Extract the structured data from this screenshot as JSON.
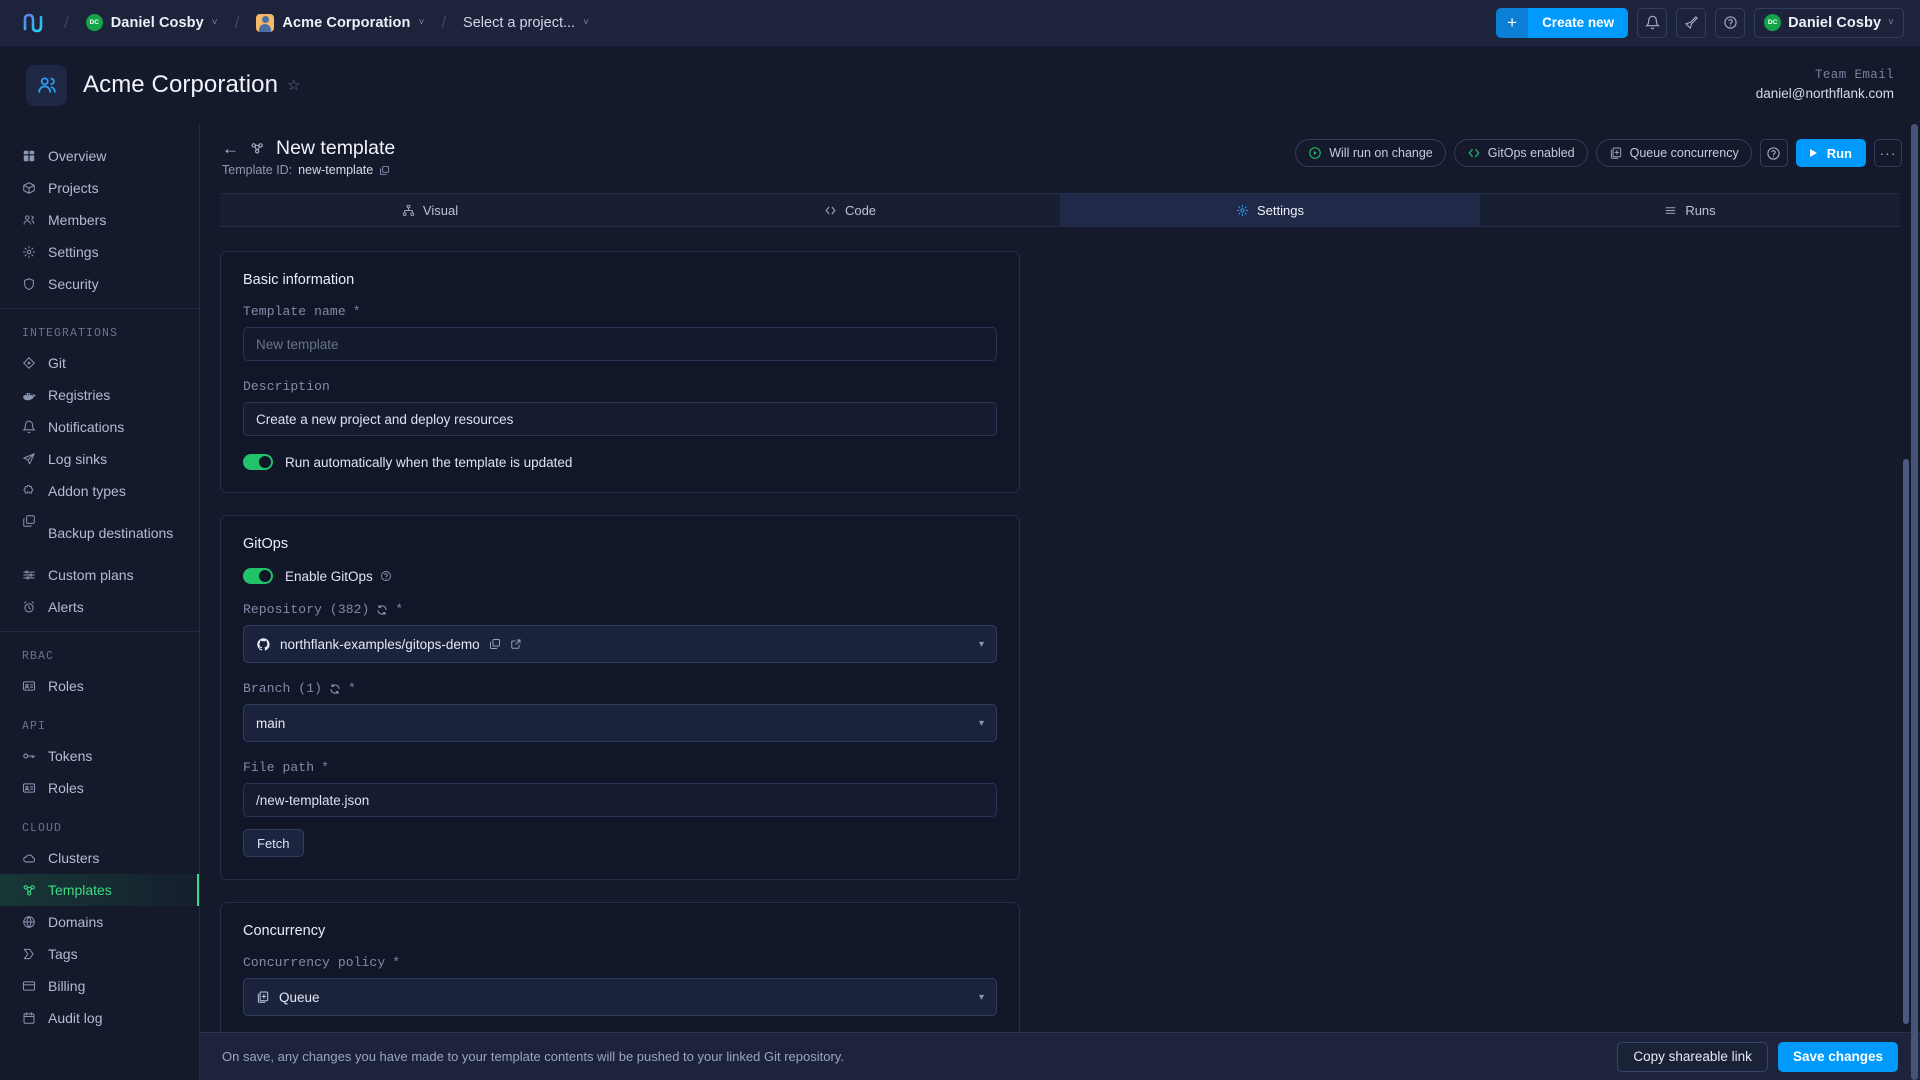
{
  "topbar": {
    "logo_icon": "northflank-logo-icon",
    "user": {
      "label": "Daniel Cosby",
      "avatar_initials": "DC",
      "chevron": "˅"
    },
    "team": {
      "label": "Acme Corporation",
      "chevron": "˅"
    },
    "project_selector": {
      "label": "Select a project...",
      "chevron": "˅"
    },
    "separator": "/",
    "create_new": {
      "plus": "+",
      "label": "Create new"
    },
    "icons": [
      "bell-icon",
      "rocket-icon",
      "help-icon"
    ],
    "account": {
      "label": "Daniel Cosby",
      "avatar_initials": "DC",
      "chevron": "˅"
    }
  },
  "team_header": {
    "avatar_icon": "team-people-icon",
    "title": "Acme Corporation",
    "star": "☆",
    "email_label": "Team Email",
    "email_value": "daniel@northflank.com"
  },
  "sidebar": {
    "items": [
      {
        "label": "Overview",
        "icon": "grid-icon",
        "active": false
      },
      {
        "label": "Projects",
        "icon": "box-icon",
        "active": false
      },
      {
        "label": "Members",
        "icon": "people-icon",
        "active": false
      },
      {
        "label": "Settings",
        "icon": "gear-icon",
        "active": false
      },
      {
        "label": "Security",
        "icon": "shield-icon",
        "active": false
      }
    ],
    "groups": [
      {
        "label": "INTEGRATIONS",
        "items": [
          {
            "label": "Git",
            "icon": "git-icon",
            "active": false
          },
          {
            "label": "Registries",
            "icon": "docker-icon",
            "active": false
          },
          {
            "label": "Notifications",
            "icon": "bell-icon",
            "active": false
          },
          {
            "label": "Log sinks",
            "icon": "send-icon",
            "active": false
          },
          {
            "label": "Addon types",
            "icon": "puzzle-icon",
            "active": false
          },
          {
            "label": "Backup destinations",
            "icon": "copy-icon",
            "active": false,
            "two_line": true
          },
          {
            "label": "Custom plans",
            "icon": "sliders-icon",
            "active": false
          },
          {
            "label": "Alerts",
            "icon": "alarm-icon",
            "active": false
          }
        ]
      },
      {
        "label": "RBAC",
        "items": [
          {
            "label": "Roles",
            "icon": "id-card-icon",
            "active": false
          }
        ]
      },
      {
        "label": "API",
        "items": [
          {
            "label": "Tokens",
            "icon": "key-icon",
            "active": false
          },
          {
            "label": "Roles",
            "icon": "id-card-icon",
            "active": false
          }
        ]
      },
      {
        "label": "CLOUD",
        "items": [
          {
            "label": "Clusters",
            "icon": "cloud-icon",
            "active": false
          },
          {
            "label": "Templates",
            "icon": "template-icon",
            "active": true
          },
          {
            "label": "Domains",
            "icon": "globe-icon",
            "active": false
          },
          {
            "label": "Tags",
            "icon": "tag-icon",
            "active": false
          },
          {
            "label": "Billing",
            "icon": "card-icon",
            "active": false
          },
          {
            "label": "Audit log",
            "icon": "calendar-icon",
            "active": false
          }
        ]
      }
    ]
  },
  "page": {
    "back_arrow": "←",
    "title_icon": "template-icon",
    "title": "New template",
    "template_id_label": "Template ID:",
    "template_id_value": "new-template",
    "copy_icon": "copy-icon",
    "pills": [
      {
        "label": "Will run on change",
        "icon": "play-circle-icon",
        "icon_color": "#21c26a"
      },
      {
        "label": "GitOps enabled",
        "icon": "code-icon",
        "icon_color": "#21c26a"
      },
      {
        "label": "Queue concurrency",
        "icon": "queue-icon",
        "icon_color": "#9aa5c0"
      }
    ],
    "help_icon": "help-icon",
    "run_button": {
      "label": "Run",
      "icon": "play-icon"
    },
    "more_button": "···",
    "tabs": [
      {
        "label": "Visual",
        "icon": "sitemap-icon",
        "active": false
      },
      {
        "label": "Code",
        "icon": "code-icon",
        "active": false
      },
      {
        "label": "Settings",
        "icon": "gear-icon",
        "active": true
      },
      {
        "label": "Runs",
        "icon": "list-icon",
        "active": false
      }
    ]
  },
  "basic_information": {
    "title": "Basic information",
    "template_name_label": "Template name",
    "template_name_required": "*",
    "template_name_placeholder": "New template",
    "template_name_value": "",
    "description_label": "Description",
    "description_value": "Create a new project and deploy resources",
    "auto_run_toggle": {
      "label": "Run automatically when the template is updated",
      "on": true
    }
  },
  "gitops": {
    "title": "GitOps",
    "enable_toggle": {
      "label": "Enable GitOps",
      "on": true,
      "help_icon": "help-icon"
    },
    "repository_label": "Repository (382)",
    "repository_required": "*",
    "repository_refresh_icon": "refresh-icon",
    "repository_value": "northflank-examples/gitops-demo",
    "repository_provider_icon": "github-icon",
    "repository_copy_icon": "copy-icon",
    "repository_external_icon": "external-link-icon",
    "branch_label": "Branch (1)",
    "branch_required": "*",
    "branch_refresh_icon": "refresh-icon",
    "branch_value": "main",
    "file_path_label": "File path",
    "file_path_required": "*",
    "file_path_value": "/new-template.json",
    "fetch_button": "Fetch"
  },
  "concurrency": {
    "title": "Concurrency",
    "policy_label": "Concurrency policy",
    "policy_required": "*",
    "policy_value": "Queue",
    "policy_icon": "queue-icon"
  },
  "savebar": {
    "message": "On save, any changes you have made to your template contents will be pushed to your linked Git repository.",
    "copy_link_button": "Copy shareable link",
    "save_button": "Save changes"
  },
  "colors": {
    "accent_blue": "#009afc",
    "accent_green": "#3ddc84",
    "toggle_green": "#21c26a",
    "bg": "#141a2b",
    "card_bg": "#111729",
    "topbar_bg": "#1c233b"
  }
}
